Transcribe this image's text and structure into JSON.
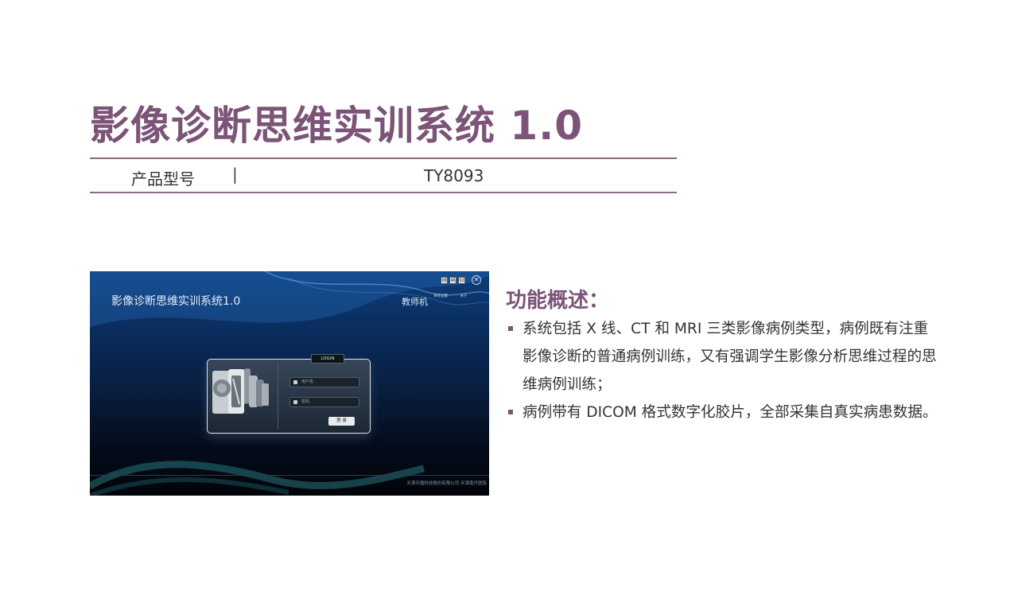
{
  "header": {
    "title": "影像诊断思维实训系统 1.0",
    "model_label": "产品型号",
    "model_separator": "|",
    "model_value": "TY8093"
  },
  "screenshot": {
    "app_title": "影像诊断思维实训系统1.0",
    "role": "教师机",
    "top_links": [
      "系统设置",
      "关于"
    ],
    "clock": [
      "08",
      "46",
      "02"
    ],
    "close_symbol": "×",
    "login_tag": "LOGIN",
    "username_placeholder": "用户名",
    "password_placeholder": "密码",
    "submit_label": "登 录",
    "footer": "天津天堰科技股份有限公司 天津南开医院",
    "colors": {
      "bg_top": "#0c3e7a",
      "bg_bottom": "#020408"
    }
  },
  "features": {
    "heading": "功能概述：",
    "items": [
      "系统包括 X 线、CT 和 MRI 三类影像病例类型，病例既有注重影像诊断的普通病例训练，又有强调学生影像分析思维过程的思维病例训练；",
      "病例带有 DICOM 格式数字化胶片，全部采集自真实病患数据。"
    ]
  },
  "colors": {
    "accent": "#7b5478",
    "text": "#333333"
  }
}
